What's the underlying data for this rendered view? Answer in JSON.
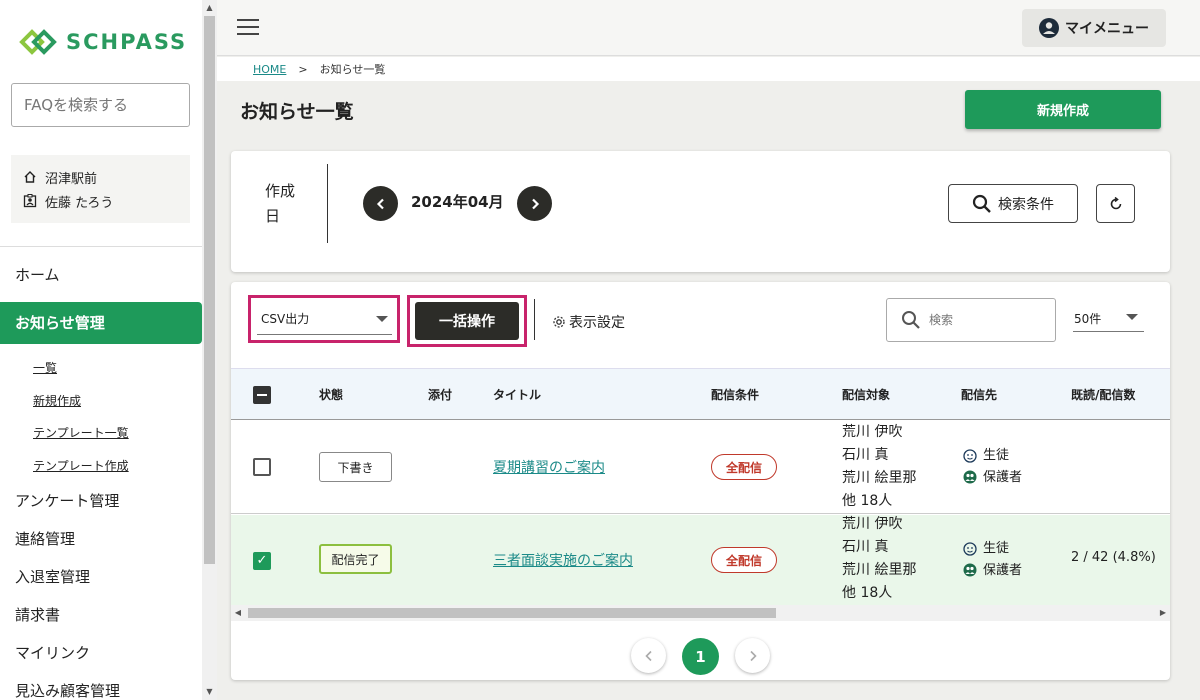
{
  "brand": {
    "name": "SCHPASS",
    "color": "#1e9a5a",
    "accent_pink": "#c8236b"
  },
  "sidebar": {
    "faq_placeholder": "FAQを検索する",
    "school": "沼津駅前",
    "user": "佐藤 たろう",
    "nav": {
      "home": "ホーム",
      "notices": "お知らせ管理",
      "sub": [
        "一覧",
        "新規作成",
        "テンプレート一覧",
        "テンプレート作成"
      ],
      "survey": "アンケート管理",
      "contact": "連絡管理",
      "entry": "入退室管理",
      "invoice": "請求書",
      "mylink": "マイリンク",
      "prospect": "見込み顧客管理"
    }
  },
  "header": {
    "my_menu": "マイメニュー"
  },
  "breadcrumb": {
    "home": "HOME",
    "separator": ">",
    "current": "お知らせ一覧"
  },
  "page": {
    "title": "お知らせ一覧",
    "new_button": "新規作成"
  },
  "date_filter": {
    "label": "作成日",
    "month": "2024年04月",
    "search_conditions": "検索条件"
  },
  "toolbar": {
    "csv_select": "CSV出力",
    "bulk_action": "一括操作",
    "display_settings": "表示設定",
    "search_placeholder": "検索",
    "per_page": "50件"
  },
  "table": {
    "headers": {
      "status": "状態",
      "attach": "添付",
      "title": "タイトル",
      "condition": "配信条件",
      "target": "配信対象",
      "destination": "配信先",
      "read": "既読/配信数"
    },
    "rows": [
      {
        "checked": false,
        "status": "下書き",
        "title": "夏期講習のご案内",
        "condition": "全配信",
        "targets": [
          "荒川 伊吹",
          "石川 真",
          "荒川 絵里那",
          "他 18人"
        ],
        "destinations": [
          "生徒",
          "保護者"
        ],
        "read": ""
      },
      {
        "checked": true,
        "status": "配信完了",
        "title": "三者面談実施のご案内",
        "condition": "全配信",
        "targets": [
          "荒川 伊吹",
          "石川 真",
          "荒川 絵里那",
          "他 18人"
        ],
        "destinations": [
          "生徒",
          "保護者"
        ],
        "read": "2 / 42 (4.8%)"
      }
    ]
  },
  "pagination": {
    "current": "1"
  }
}
